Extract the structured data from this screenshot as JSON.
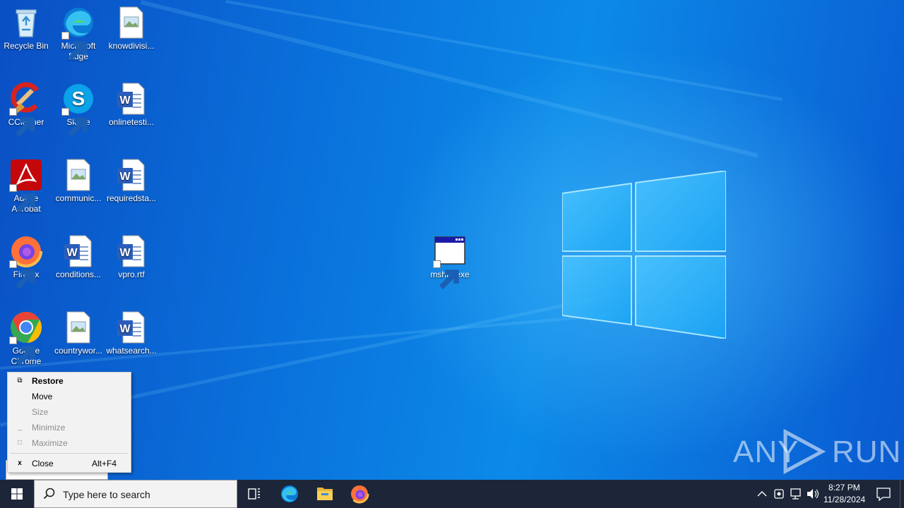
{
  "desktop": {
    "icons": [
      {
        "label": "Recycle Bin",
        "icon": "recycle-bin-icon"
      },
      {
        "label": "Microsoft Edge",
        "icon": "edge-icon"
      },
      {
        "label": "knowdivisi...",
        "icon": "image-file-icon"
      },
      {
        "label": "CCleaner",
        "icon": "ccleaner-icon"
      },
      {
        "label": "Skype",
        "icon": "skype-icon"
      },
      {
        "label": "onlinetesti...",
        "icon": "word-doc-icon"
      },
      {
        "label": "Adobe Acrobat",
        "icon": "acrobat-icon"
      },
      {
        "label": "communic...",
        "icon": "image-file-icon"
      },
      {
        "label": "requiredsta...",
        "icon": "word-doc-icon"
      },
      {
        "label": "Firefox",
        "icon": "firefox-icon"
      },
      {
        "label": "conditions...",
        "icon": "word-doc-icon"
      },
      {
        "label": "vpro.rtf",
        "icon": "word-doc-icon"
      },
      {
        "label": "Google Chrome",
        "icon": "chrome-icon"
      },
      {
        "label": "countrywor...",
        "icon": "image-file-icon"
      },
      {
        "label": "whatsearch...",
        "icon": "word-doc-icon"
      },
      {
        "label": "mshta.exe",
        "icon": "app-window-icon"
      }
    ]
  },
  "system_menu": {
    "items": [
      {
        "label": "Restore",
        "icon": "restore-icon",
        "enabled": true,
        "bold": true
      },
      {
        "label": "Move",
        "enabled": true
      },
      {
        "label": "Size",
        "enabled": false
      },
      {
        "label": "Minimize",
        "icon": "minimize-icon",
        "enabled": false
      },
      {
        "label": "Maximize",
        "icon": "maximize-icon",
        "enabled": false
      },
      {
        "label": "Close",
        "icon": "close-icon",
        "enabled": true,
        "accelerator": "Alt+F4"
      }
    ]
  },
  "watermark": {
    "left": "ANY",
    "right": "RUN"
  },
  "taskbar": {
    "search_placeholder": "Type here to search",
    "pinned": [
      "task-view-icon",
      "edge-icon",
      "file-explorer-icon",
      "firefox-icon"
    ],
    "clock_time": "8:27 PM",
    "clock_date": "11/28/2024"
  },
  "colors": {
    "taskbar": "#1c2638",
    "menu_bg": "#f2f2f2",
    "desktop_blue": "#0a72dc"
  }
}
